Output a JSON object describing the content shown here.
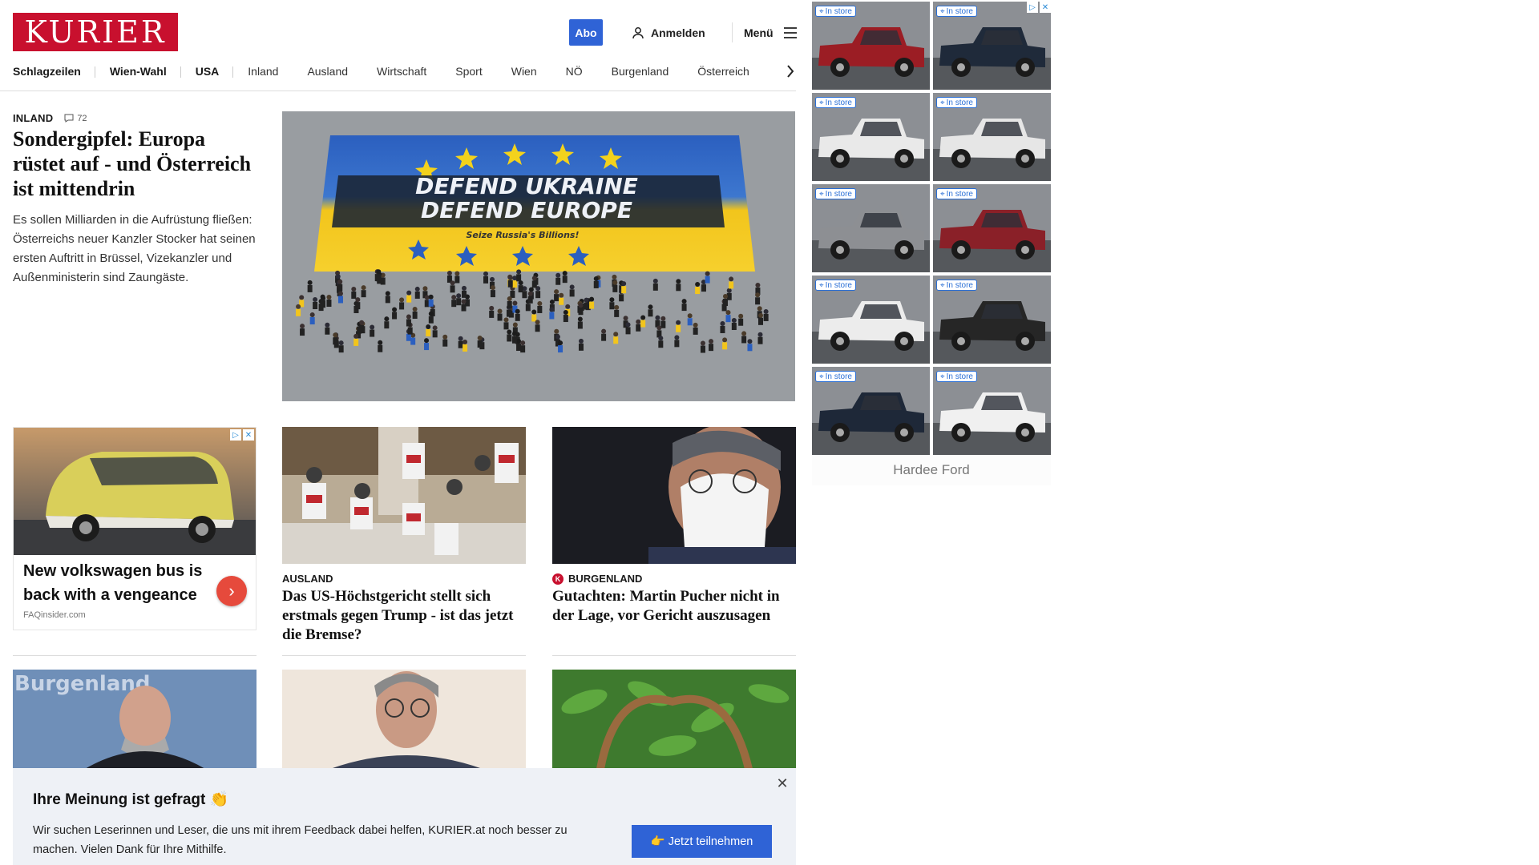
{
  "header": {
    "logo_text": "KURIER",
    "abo_label": "Abo",
    "login_label": "Anmelden",
    "menu_label": "Menü",
    "brand_color": "#c8102e",
    "accent_color": "#2f63d6"
  },
  "nav": {
    "items": [
      {
        "label": "Schlagzeilen",
        "bold": true
      },
      {
        "label": "Wien-Wahl",
        "bold": true
      },
      {
        "label": "USA",
        "bold": true
      },
      {
        "label": "Inland"
      },
      {
        "label": "Ausland"
      },
      {
        "label": "Wirtschaft"
      },
      {
        "label": "Sport"
      },
      {
        "label": "Wien"
      },
      {
        "label": "NÖ"
      },
      {
        "label": "Burgenland"
      },
      {
        "label": "Österreich"
      }
    ],
    "more_icon": "chevron-right-icon"
  },
  "lead": {
    "kicker": "INLAND",
    "comment_count": "72",
    "title": "Sondergipfel: Europa rüstet auf - und Österreich ist mittendrin",
    "teaser": "Es sollen Milliarden in die Aufrüstung fließen: Österreichs neuer Kanzler Stocker hat seinen ersten Auftritt in Brüssel, Vizekanzler und Außenministerin sind Zaungäste.",
    "banner_line1": "DEFEND UKRAINE",
    "banner_line2": "DEFEND EUROPE",
    "banner_line3": "Seize Russia's Billions!"
  },
  "ad_car": {
    "title": "New volkswagen bus is back with a vengeance",
    "source": "FAQinsider.com"
  },
  "teasers": [
    {
      "kicker": "AUSLAND",
      "title": "Das US-Höchstgericht stellt sich erstmals gegen Trump - ist das jetzt die Bremse?"
    },
    {
      "kicker": "BURGENLAND",
      "title": "Gutachten: Martin Pucher nicht in der Lage, vor Gericht auszusagen",
      "badge": "K"
    }
  ],
  "bottom_row": {
    "first_image_text": "Burgenland"
  },
  "ad_grid": {
    "badge_label": "In store",
    "dealer": "Hardee Ford",
    "tiles": [
      {
        "color": "#9b1d24"
      },
      {
        "color": "#1f2a3a"
      },
      {
        "color": "#e9e9e9"
      },
      {
        "color": "#e6e6e6"
      },
      {
        "color": "#8d8f93"
      },
      {
        "color": "#8a2028"
      },
      {
        "color": "#ececec"
      },
      {
        "color": "#262626"
      },
      {
        "color": "#1e2838"
      },
      {
        "color": "#f0f0f0"
      }
    ]
  },
  "survey": {
    "title": "Ihre Meinung ist gefragt 👏",
    "text": "Wir suchen Leserinnen und Leser, die uns mit ihrem Feedback dabei helfen, KURIER.at noch besser zu machen. Vielen Dank für Ihre Mithilfe.",
    "button_label": "👉 Jetzt teilnehmen"
  }
}
